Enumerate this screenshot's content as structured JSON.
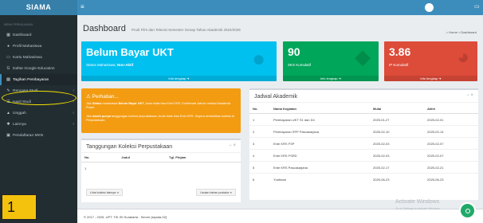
{
  "app": {
    "brand": "SIAMA"
  },
  "sidebar": {
    "header": "MENU PERKULIAHAN",
    "items": [
      {
        "label": "Dashboard",
        "icon": "dashboard-icon",
        "glyph": "▦",
        "active": false,
        "has_submenu": false
      },
      {
        "label": "Profil Mahasiswa",
        "icon": "user-icon",
        "glyph": "●",
        "active": false,
        "has_submenu": false
      },
      {
        "label": "Kartu Mahasiswa",
        "icon": "card-icon",
        "glyph": "▭",
        "active": false,
        "has_submenu": false
      },
      {
        "label": "Daftar Google Education",
        "icon": "google-icon",
        "glyph": "G",
        "active": false,
        "has_submenu": false
      },
      {
        "label": "Tagihan Pembayaran",
        "icon": "invoice-icon",
        "glyph": "▤",
        "active": true,
        "has_submenu": false
      },
      {
        "label": "Rencana Studi",
        "icon": "edit-icon",
        "glyph": "✎",
        "active": false,
        "has_submenu": true
      },
      {
        "label": "Hasil Studi",
        "icon": "list-icon",
        "glyph": "☰",
        "active": false,
        "has_submenu": true
      },
      {
        "label": "Unggah",
        "icon": "upload-icon",
        "glyph": "▲",
        "active": false,
        "has_submenu": true
      },
      {
        "label": "Lainnya",
        "icon": "cog-icon",
        "glyph": "✱",
        "active": false,
        "has_submenu": true
      },
      {
        "label": "Pendaftaran MKN",
        "icon": "register-icon",
        "glyph": "▣",
        "active": false,
        "has_submenu": false
      }
    ],
    "chevron": "‹"
  },
  "header": {
    "menu_glyph": "≡",
    "monitor_glyph": "▭"
  },
  "page": {
    "title": "Dashboard",
    "subtitle": "Prodi Film dan Televisi Semester Genap Tahun Akademik 2024/2025",
    "breadcrumb_home": "Home",
    "breadcrumb_current": "Dashboard"
  },
  "info_boxes": [
    {
      "big": "Belum Bayar UKT",
      "sub_label": "Status Mahasiswa:",
      "sub_value": "Non-Aktif",
      "footer": "Info lengkap ➔",
      "color": "#00c0ef",
      "icon": "user-icon"
    },
    {
      "big": "90",
      "sub_label": "SKS Kumulatif",
      "sub_value": "",
      "footer": "Info lengkap ➔",
      "color": "#00a65a",
      "icon": "bag-icon"
    },
    {
      "big": "3.86",
      "sub_label": "IP Kumulatif",
      "sub_value": "",
      "footer": "Info lengkap ➔",
      "color": "#dd4b39",
      "icon": "pie-chart-icon"
    }
  ],
  "alert": {
    "title": "Perhatian...",
    "line1_a": "Jika",
    "line1_status": "Status",
    "line1_b": "mahasiswa",
    "line1_value": "Belum Bayar UKT",
    "line1_c": ", Anda tidak bisa Entri KRS. Konfirmasi dahulu melalui Akademik Pusat.",
    "line2_a": "Jika",
    "line2_value": "masih punya",
    "line2_b": "tanggungan koleksi perpustakaan, Anda tidak bisa Entri KRS. Segera kembalikan koleksi di Perpustakaan."
  },
  "library": {
    "title": "Tanggungan Koleksi Perpustakaan",
    "columns": [
      "No.",
      "Judul",
      "Tgl. Pinjam"
    ],
    "rows": [
      [
        "1",
        "",
        ""
      ]
    ],
    "btn_left": "Lihat koleksi lainnya ➔",
    "btn_right": "Usulan bahan pustaka ➔"
  },
  "schedule": {
    "title": "Jadwal Akademik",
    "columns": [
      "No.",
      "Nama Kegiatan",
      "Mulai",
      "Akhir"
    ],
    "rows": [
      [
        "1",
        "Pembayaran UKT S1 dan D4",
        "2025-01-27",
        "2025-02-01"
      ],
      [
        "2",
        "Pembayaran SPP Pascasarjana",
        "2025-02-10",
        "2025-02-14"
      ],
      [
        "3",
        "Entri KRS FSP",
        "2025-02-03",
        "2025-02-07"
      ],
      [
        "4",
        "Entri KRS FSRD",
        "2025-02-03",
        "2025-02-07"
      ],
      [
        "5",
        "Entri KRS Pascasarjana",
        "2025-02-17",
        "2025-02-21"
      ],
      [
        "6",
        "Yudisium",
        "2025-06-23",
        "2025-06-23"
      ]
    ]
  },
  "footer": {
    "text": "© 2017 - 2025, UPT. TIK ISI Surakarta - Server [siyada-02]"
  },
  "overlay": {
    "number": "1",
    "activate_title": "Activate Windows",
    "activate_sub": "Go to Settings to activate Windows."
  },
  "tools": {
    "minimize": "−",
    "close": "×"
  }
}
